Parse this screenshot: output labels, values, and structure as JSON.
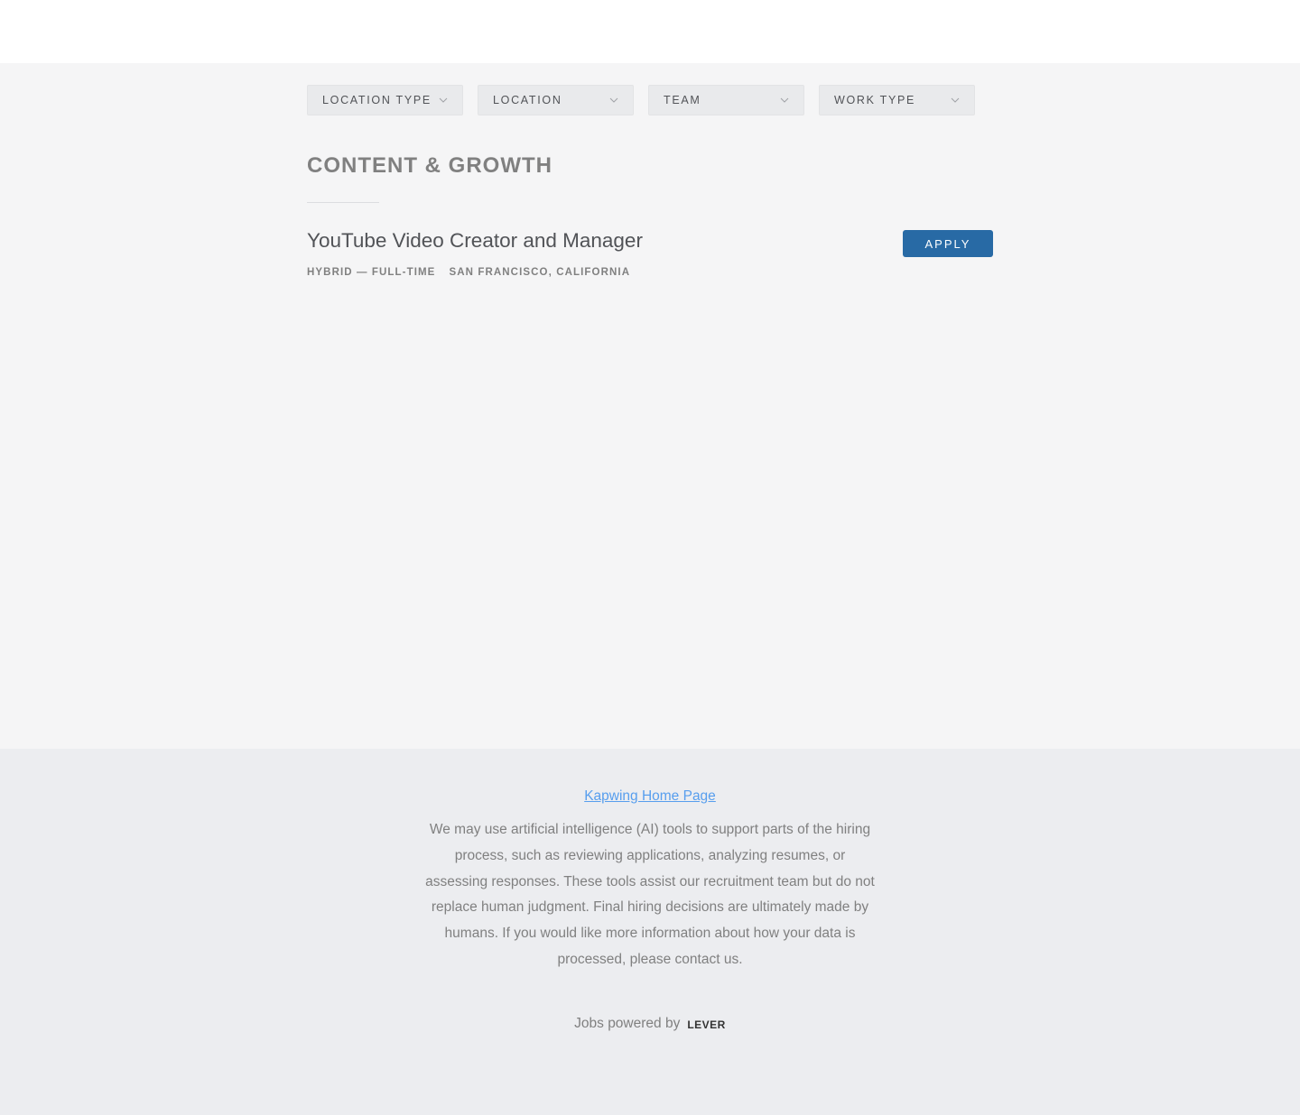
{
  "filters": [
    {
      "label": "LOCATION TYPE",
      "icon": "chevron-down-icon"
    },
    {
      "label": "LOCATION",
      "icon": "chevron-down-icon"
    },
    {
      "label": "TEAM",
      "icon": "chevron-down-icon"
    },
    {
      "label": "WORK TYPE",
      "icon": "chevron-down-icon"
    }
  ],
  "section": {
    "title": "CONTENT & GROWTH"
  },
  "posting": {
    "title": "YouTube Video Creator and Manager",
    "commitment": "HYBRID — FULL-TIME",
    "location": "SAN FRANCISCO, CALIFORNIA",
    "apply_label": "APPLY"
  },
  "footer": {
    "home_link": "Kapwing Home Page",
    "disclaimer": "We may use artificial intelligence (AI) tools to support parts of the hiring process, such as reviewing applications, analyzing resumes, or assessing responses. These tools assist our recruitment team but do not replace human judgment. Final hiring decisions are ultimately made by humans. If you would like more information about how your data is processed, please contact us.",
    "powered_by": "Jobs powered by",
    "brand": "LEVER"
  },
  "colors": {
    "accent": "#286aa5",
    "link": "#579eee",
    "background": "#f5f5f6",
    "footer_background": "#ecedf0"
  }
}
